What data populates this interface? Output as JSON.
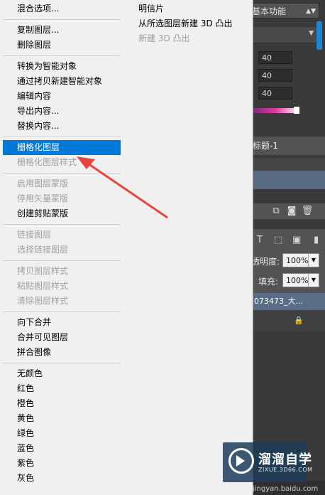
{
  "context_menu": {
    "groups": [
      [
        {
          "label": "混合选项...",
          "enabled": true
        }
      ],
      [
        {
          "label": "复制图层...",
          "enabled": true
        },
        {
          "label": "删除图层",
          "enabled": true
        }
      ],
      [
        {
          "label": "转换为智能对象",
          "enabled": true
        },
        {
          "label": "通过拷贝新建智能对象",
          "enabled": true
        },
        {
          "label": "编辑内容",
          "enabled": true
        },
        {
          "label": "导出内容...",
          "enabled": true
        },
        {
          "label": "替换内容...",
          "enabled": true
        }
      ],
      [
        {
          "label": "栅格化图层",
          "enabled": true,
          "highlighted": true
        },
        {
          "label": "栅格化图层样式",
          "enabled": false
        }
      ],
      [
        {
          "label": "启用图层蒙版",
          "enabled": false
        },
        {
          "label": "停用矢量蒙版",
          "enabled": false
        },
        {
          "label": "创建剪贴蒙版",
          "enabled": true
        }
      ],
      [
        {
          "label": "链接图层",
          "enabled": false
        },
        {
          "label": "选择链接图层",
          "enabled": false
        }
      ],
      [
        {
          "label": "拷贝图层样式",
          "enabled": false
        },
        {
          "label": "粘贴图层样式",
          "enabled": false
        },
        {
          "label": "清除图层样式",
          "enabled": false
        }
      ],
      [
        {
          "label": "向下合并",
          "enabled": true
        },
        {
          "label": "合并可见图层",
          "enabled": true
        },
        {
          "label": "拼合图像",
          "enabled": true
        }
      ],
      [
        {
          "label": "无颜色",
          "enabled": true
        },
        {
          "label": "红色",
          "enabled": true
        },
        {
          "label": "橙色",
          "enabled": true
        },
        {
          "label": "黄色",
          "enabled": true
        },
        {
          "label": "绿色",
          "enabled": true
        },
        {
          "label": "蓝色",
          "enabled": true
        },
        {
          "label": "紫色",
          "enabled": true
        },
        {
          "label": "灰色",
          "enabled": true
        }
      ]
    ]
  },
  "submenu": {
    "items": [
      {
        "label": "明信片",
        "enabled": true
      },
      {
        "label": "从所选图层新建 3D 凸出",
        "enabled": true
      },
      {
        "label": "新建 3D 凸出",
        "enabled": false
      }
    ]
  },
  "panel": {
    "workspace": "基本功能",
    "values": [
      "40",
      "40",
      "40"
    ],
    "doc_tab": "标题-1",
    "opacity_label": "透明度:",
    "opacity_value": "100%",
    "fill_label": "填充:",
    "fill_value": "100%",
    "layer_name": "073473_大...",
    "site": "jingyan.baidu.com"
  },
  "watermark": {
    "title": "溜溜自学",
    "subtitle": "ZIXUE.3D66.COM"
  },
  "colors": {
    "highlight": "#0078d7",
    "arrow": "#e8453c",
    "menu_bg": "#f0f0f0"
  }
}
